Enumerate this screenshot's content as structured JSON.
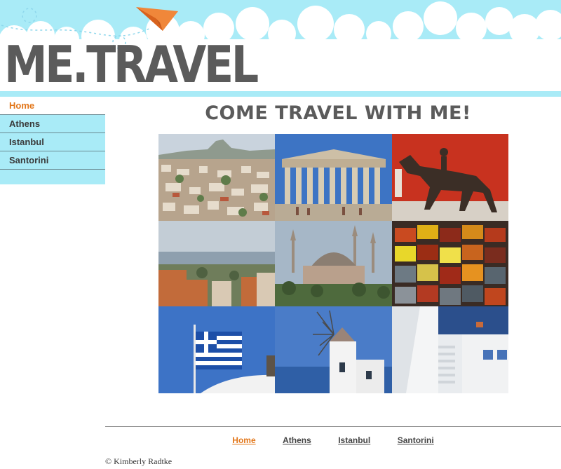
{
  "brand": {
    "logo_text": "ME.TRAVEL",
    "colors": {
      "sky": "#a9ebf7",
      "accent": "#e27619",
      "logo": "#5b5b5b"
    }
  },
  "sidebar": {
    "items": [
      {
        "label": "Home",
        "active": true
      },
      {
        "label": "Athens",
        "active": false
      },
      {
        "label": "Istanbul",
        "active": false
      },
      {
        "label": "Santorini",
        "active": false
      }
    ]
  },
  "main": {
    "title": "COME TRAVEL WITH ME!",
    "photos": [
      {
        "subject": "athens-cityscape"
      },
      {
        "subject": "parthenon"
      },
      {
        "subject": "horse-and-jockey-statue"
      },
      {
        "subject": "istanbul-harbor-view"
      },
      {
        "subject": "hagia-sophia"
      },
      {
        "subject": "spice-market"
      },
      {
        "subject": "greek-flag"
      },
      {
        "subject": "santorini-windmill"
      },
      {
        "subject": "santorini-stairs"
      }
    ]
  },
  "footer": {
    "links": [
      {
        "label": "Home",
        "active": true
      },
      {
        "label": "Athens",
        "active": false
      },
      {
        "label": "Istanbul",
        "active": false
      },
      {
        "label": "Santorini",
        "active": false
      }
    ],
    "copyright": "© Kimberly Radtke"
  },
  "icons": {
    "logo_decoration": "paper-airplane-icon"
  }
}
